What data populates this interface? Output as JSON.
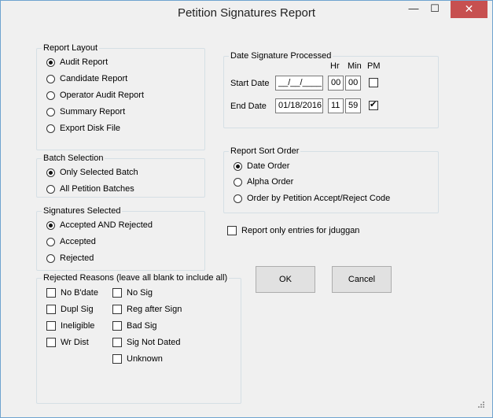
{
  "window": {
    "title": "Petition Signatures Report",
    "minimize": "—",
    "maximize": "☐",
    "close": "✕"
  },
  "report_layout": {
    "legend": "Report Layout",
    "options": [
      {
        "label": "Audit Report",
        "selected": true
      },
      {
        "label": "Candidate Report",
        "selected": false
      },
      {
        "label": "Operator Audit Report",
        "selected": false
      },
      {
        "label": "Summary Report",
        "selected": false
      },
      {
        "label": "Export Disk File",
        "selected": false
      }
    ]
  },
  "batch_selection": {
    "legend": "Batch Selection",
    "options": [
      {
        "label": "Only Selected Batch",
        "selected": true
      },
      {
        "label": "All Petition Batches",
        "selected": false
      }
    ]
  },
  "signatures_selected": {
    "legend": "Signatures Selected",
    "options": [
      {
        "label": "Accepted AND Rejected",
        "selected": true
      },
      {
        "label": "Accepted",
        "selected": false
      },
      {
        "label": "Rejected",
        "selected": false
      }
    ]
  },
  "rejected_reasons": {
    "legend": "Rejected Reasons (leave all blank to include all)",
    "col1": [
      "No B'date",
      "Dupl Sig",
      "Ineligible",
      "Wr Dist"
    ],
    "col2": [
      "No Sig",
      "Reg after Sign",
      "Bad Sig",
      "Sig Not Dated",
      "Unknown"
    ]
  },
  "date_processed": {
    "legend": "Date Signature Processed",
    "hr_label": "Hr",
    "min_label": "Min",
    "pm_label": "PM",
    "start": {
      "label": "Start Date",
      "date": "__/__/____",
      "hr": "00",
      "min": "00",
      "pm": false
    },
    "end": {
      "label": "End Date",
      "date": "01/18/2016",
      "hr": "11",
      "min": "59",
      "pm": true
    }
  },
  "sort_order": {
    "legend": "Report Sort Order",
    "options": [
      {
        "label": "Date Order",
        "selected": true
      },
      {
        "label": "Alpha Order",
        "selected": false
      },
      {
        "label": "Order by Petition Accept/Reject Code",
        "selected": false
      }
    ]
  },
  "report_only": {
    "label": "Report only entries for jduggan",
    "checked": false
  },
  "buttons": {
    "ok": "OK",
    "cancel": "Cancel"
  }
}
